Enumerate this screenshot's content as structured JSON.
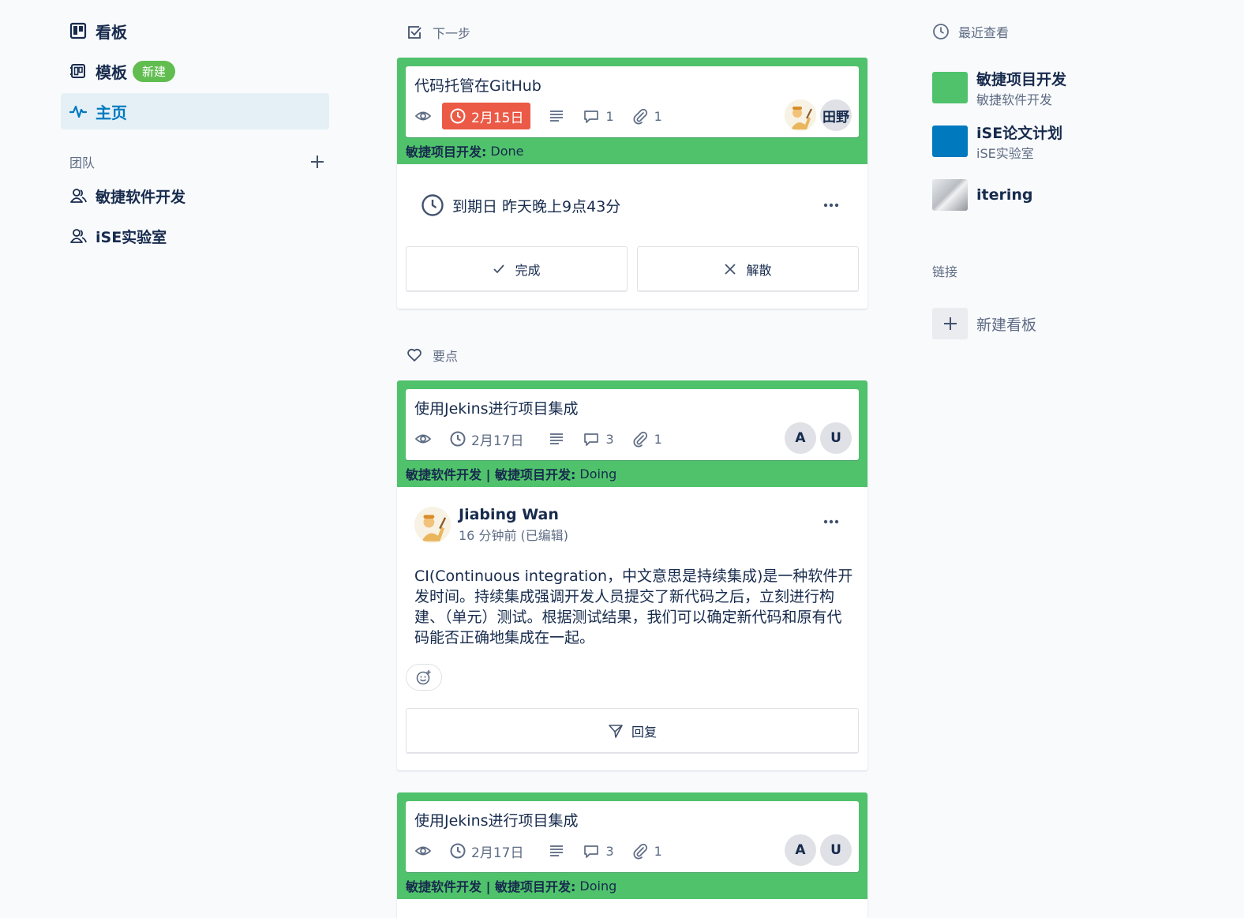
{
  "sidebar": {
    "boards_label": "看板",
    "templates_label": "模板",
    "templates_badge": "新建",
    "home_label": "主页",
    "teams_header": "团队",
    "teams": [
      {
        "label": "敏捷软件开发"
      },
      {
        "label": "iSE实验室"
      }
    ]
  },
  "up_next": {
    "header": "下一步",
    "card": {
      "title": "代码托管在GitHub",
      "due": "2月15日",
      "comments": "1",
      "attachments": "1",
      "member_label": "田野",
      "board": "敏捷项目开发:",
      "list": "Done"
    },
    "due_notice": "到期日 昨天晚上9点43分",
    "complete_label": "完成",
    "dismiss_label": "解散"
  },
  "highlights": {
    "header": "要点",
    "card": {
      "title": "使用Jekins进行项目集成",
      "due": "2月17日",
      "comments": "3",
      "attachments": "1",
      "members": [
        "A",
        "U"
      ],
      "board": "敏捷软件开发 | 敏捷项目开发:",
      "list": "Doing"
    },
    "comment": {
      "author": "Jiabing Wan",
      "time": "16 分钟前 (已编辑)",
      "body": "CI(Continuous integration，中文意思是持续集成)是一种软件开发时间。持续集成强调开发人员提交了新代码之后，立刻进行构建、（单元）测试。根据测试结果，我们可以确定新代码和原有代码能否正确地集成在一起。"
    },
    "reply_label": "回复",
    "card2": {
      "title": "使用Jekins进行项目集成",
      "due": "2月17日",
      "comments": "3",
      "attachments": "1",
      "members": [
        "A",
        "U"
      ],
      "board": "敏捷软件开发 | 敏捷项目开发:",
      "list": "Doing"
    }
  },
  "right": {
    "recent_header": "最近查看",
    "recent": [
      {
        "title": "敏捷项目开发",
        "sub": "敏捷软件开发",
        "color": "#4fc26b"
      },
      {
        "title": "iSE论文计划",
        "sub": "iSE实验室",
        "color": "#0079bf"
      },
      {
        "title": "itering",
        "sub": "",
        "color": "#c7cbd1"
      }
    ],
    "links_header": "链接",
    "new_board_label": "新建看板"
  },
  "colors": {
    "accent": "#0079bf",
    "green": "#4fc26b",
    "overdue": "#eb5a46"
  }
}
